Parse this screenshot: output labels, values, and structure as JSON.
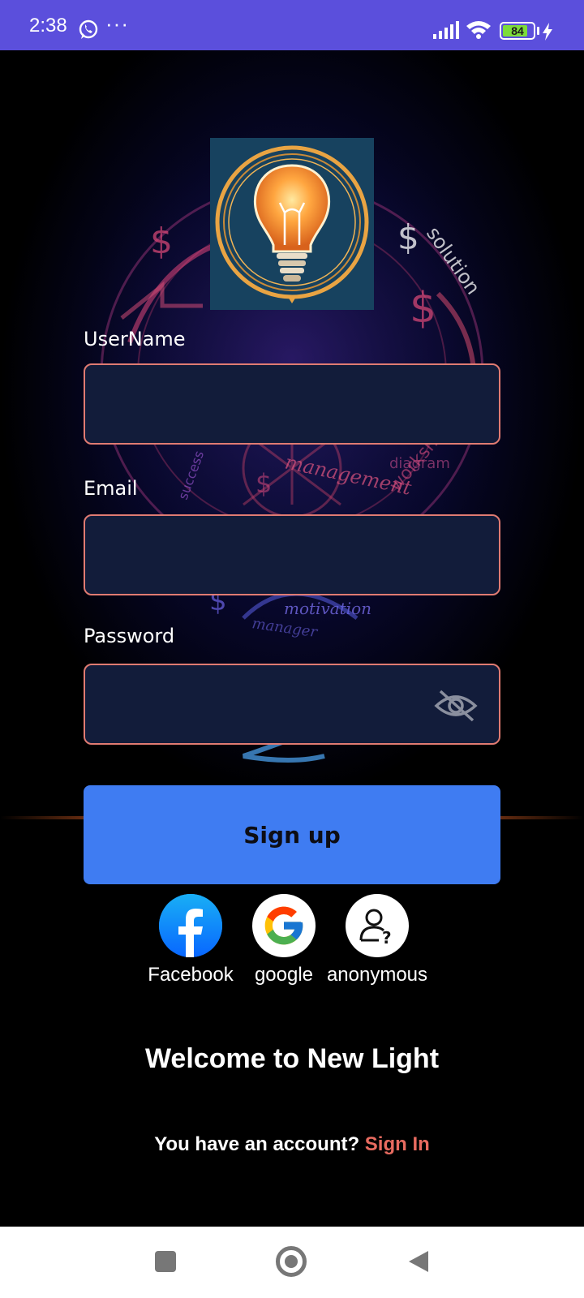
{
  "status_bar": {
    "time": "2:38",
    "dots": "···",
    "battery": "84",
    "battery_level": 0.84,
    "background_color": "#5b4fdc"
  },
  "form": {
    "username": {
      "label": "UserName",
      "value": "",
      "placeholder": ""
    },
    "email": {
      "label": "Email",
      "value": "",
      "placeholder": ""
    },
    "password": {
      "label": "Password",
      "value": "",
      "placeholder": "",
      "visibility_icon": "eye-off-icon"
    },
    "field_border_color": "#e07b72",
    "field_fill_color": "#121c3a"
  },
  "signup_button": {
    "label": "Sign up",
    "color": "#3f7cf2"
  },
  "social_logins": [
    {
      "label": "Facebook",
      "icon": "facebook-icon"
    },
    {
      "label": "google",
      "icon": "google-icon"
    },
    {
      "label": "anonymous",
      "icon": "anonymous-user-icon"
    }
  ],
  "welcome_text": "Welcome to New Light",
  "account_prompt": {
    "text": "You have an account?",
    "link": "Sign In",
    "link_color": "#e86b60"
  },
  "background_words": [
    "solution",
    "management",
    "diagram",
    "workshop",
    "motivation",
    "manager",
    "success"
  ],
  "nav_bar": {
    "recent": "square-icon",
    "home": "circle-icon",
    "back": "triangle-back-icon"
  }
}
